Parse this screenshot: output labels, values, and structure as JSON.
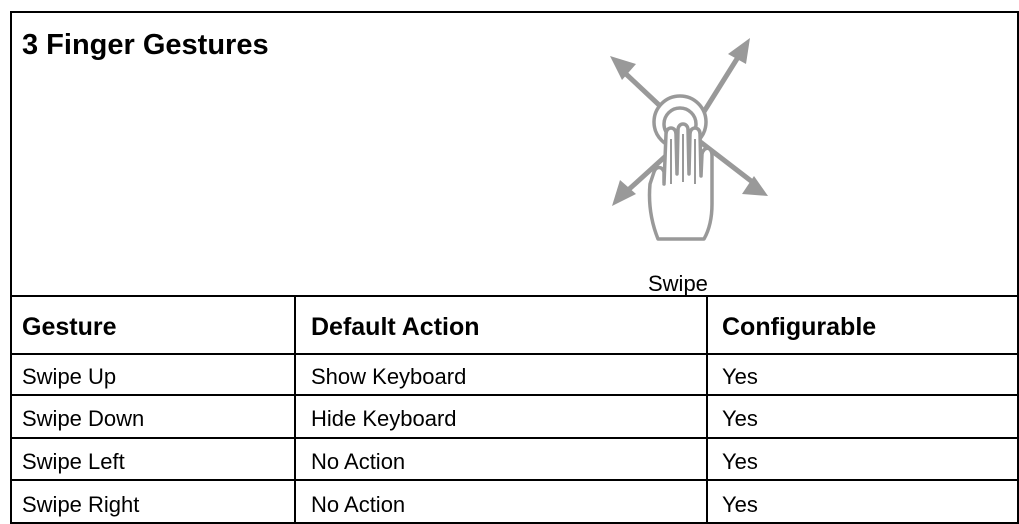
{
  "title": "3 Finger Gestures",
  "icon": {
    "name": "three-finger-swipe-icon",
    "color": "#999999",
    "caption": "Swipe"
  },
  "table": {
    "headers": [
      "Gesture",
      "Default Action",
      "Configurable"
    ],
    "rows": [
      [
        "Swipe Up",
        "Show Keyboard",
        "Yes"
      ],
      [
        "Swipe Down",
        "Hide Keyboard",
        "Yes"
      ],
      [
        "Swipe Left",
        "No Action",
        "Yes"
      ],
      [
        "Swipe Right",
        "No Action",
        "Yes"
      ]
    ]
  }
}
